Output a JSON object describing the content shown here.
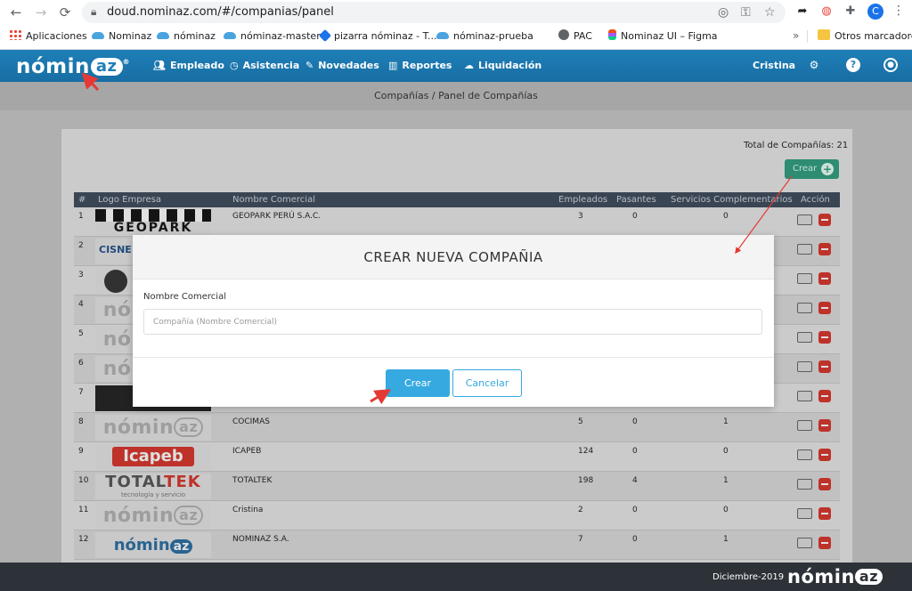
{
  "browser": {
    "url": "doud.nominaz.com/#/companias/panel",
    "profile_initial": "C",
    "bookmarks": [
      {
        "label": "Aplicaciones",
        "icon": "apps-grid-icon"
      },
      {
        "label": "Nominaz",
        "icon": "cloud-icon"
      },
      {
        "label": "nóminaz",
        "icon": "cloud-icon"
      },
      {
        "label": "nóminaz-master",
        "icon": "cloud-icon"
      },
      {
        "label": "pizarra nóminaz - T...",
        "icon": "jira-diamond-icon"
      },
      {
        "label": "nóminaz-prueba",
        "icon": "cloud-icon"
      },
      {
        "label": "PAC",
        "icon": "globe-icon"
      },
      {
        "label": "Nominaz UI – Figma",
        "icon": "figma-icon"
      }
    ],
    "bookmarks_more": "»",
    "other_bookmarks": "Otros marcadores"
  },
  "app": {
    "logo_main": "nómin",
    "logo_az": "az",
    "menu": [
      {
        "label": "Empleado",
        "icon": "users-icon"
      },
      {
        "label": "Asistencia",
        "icon": "clock-icon"
      },
      {
        "label": "Novedades",
        "icon": "edit-icon"
      },
      {
        "label": "Reportes",
        "icon": "bar-chart-icon"
      },
      {
        "label": "Liquidación",
        "icon": "cloud-upload-icon"
      }
    ],
    "user": "Cristina"
  },
  "breadcrumb": "Compañías / Panel de Compañías",
  "panel": {
    "total_label": "Total de Compañías: 21",
    "create_label": "Crear"
  },
  "table": {
    "columns": [
      "#",
      "Logo Empresa",
      "Nombre Comercial",
      "Empleados",
      "Pasantes",
      "Servicios Complementarios",
      "Acción"
    ],
    "rows": [
      {
        "n": "1",
        "logo": "geopark",
        "name": "GEOPARK PERÚ S.A.C.",
        "emp": "3",
        "pas": "0",
        "serv": "0"
      },
      {
        "n": "2",
        "logo": "cisne",
        "name": "",
        "emp": "",
        "pas": "",
        "serv": ""
      },
      {
        "n": "3",
        "logo": "avatar",
        "name": "",
        "emp": "",
        "pas": "",
        "serv": ""
      },
      {
        "n": "4",
        "logo": "nominaz",
        "name": "",
        "emp": "",
        "pas": "",
        "serv": ""
      },
      {
        "n": "5",
        "logo": "nominaz",
        "name": "",
        "emp": "",
        "pas": "",
        "serv": ""
      },
      {
        "n": "6",
        "logo": "nominaz",
        "name": "",
        "emp": "",
        "pas": "",
        "serv": ""
      },
      {
        "n": "7",
        "logo": "dark",
        "name": "",
        "emp": "",
        "pas": "",
        "serv": ""
      },
      {
        "n": "8",
        "logo": "nominaz",
        "name": "COCIMAS",
        "emp": "5",
        "pas": "0",
        "serv": "1"
      },
      {
        "n": "9",
        "logo": "icapeb",
        "name": "ICAPEB",
        "emp": "124",
        "pas": "0",
        "serv": "0"
      },
      {
        "n": "10",
        "logo": "totaltek",
        "name": "TOTALTEK",
        "emp": "198",
        "pas": "4",
        "serv": "1"
      },
      {
        "n": "11",
        "logo": "nominaz",
        "name": "Cristina",
        "emp": "2",
        "pas": "0",
        "serv": "0"
      },
      {
        "n": "12",
        "logo": "nominaz-sa",
        "name": "NOMINAZ S.A.",
        "emp": "7",
        "pas": "0",
        "serv": "1"
      }
    ],
    "logo_texts": {
      "geopark": "GEOPARK",
      "cisne": "CISNE",
      "icapeb": "Icapeb",
      "totaltek_a": "TOTAL",
      "totaltek_b": "TEK",
      "totaltek_tag": "tecnología y servicio",
      "nominaz_a": "nómin",
      "nominaz_b": "az"
    }
  },
  "modal": {
    "title": "CREAR NUEVA COMPAÑIA",
    "field_label": "Nombre Comercial",
    "field_value": "",
    "field_placeholder": "Compañía (Nombre Comercial)",
    "confirm": "Crear",
    "cancel": "Cancelar"
  },
  "footer": {
    "date": "Diciembre-2019",
    "logo_main": "nómin",
    "logo_az": "az"
  },
  "colors": {
    "header": "#1f7fb8",
    "accent": "#36a9e1",
    "create_green": "#2e9e7f",
    "danger": "#d9342b",
    "footer": "#2d3238",
    "annotation": "#e53935"
  }
}
